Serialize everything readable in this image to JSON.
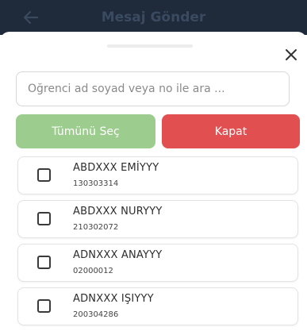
{
  "appbar": {
    "title": "Mesaj Gönder",
    "back_icon": "arrow-left-icon"
  },
  "sheet": {
    "close_icon": "close-icon",
    "search": {
      "placeholder": "Öğrenci ad soyad veya no ile ara ...",
      "value": ""
    },
    "select_all_label": "Tümünü Seç",
    "close_label": "Kapat",
    "students": [
      {
        "name": "ABDXXX EMİYYY",
        "no": "130303314",
        "checked": false
      },
      {
        "name": "ABDXXX NURYYY",
        "no": "210302072",
        "checked": false
      },
      {
        "name": "ADNXXX ANAYYY",
        "no": "02000012",
        "checked": false
      },
      {
        "name": "ADNXXX IŞIYYY",
        "no": "200304286",
        "checked": false
      }
    ]
  },
  "colors": {
    "appbar": "#1f2a3a",
    "select_all_button": "#9ccd8e",
    "close_button": "#e24f50"
  }
}
